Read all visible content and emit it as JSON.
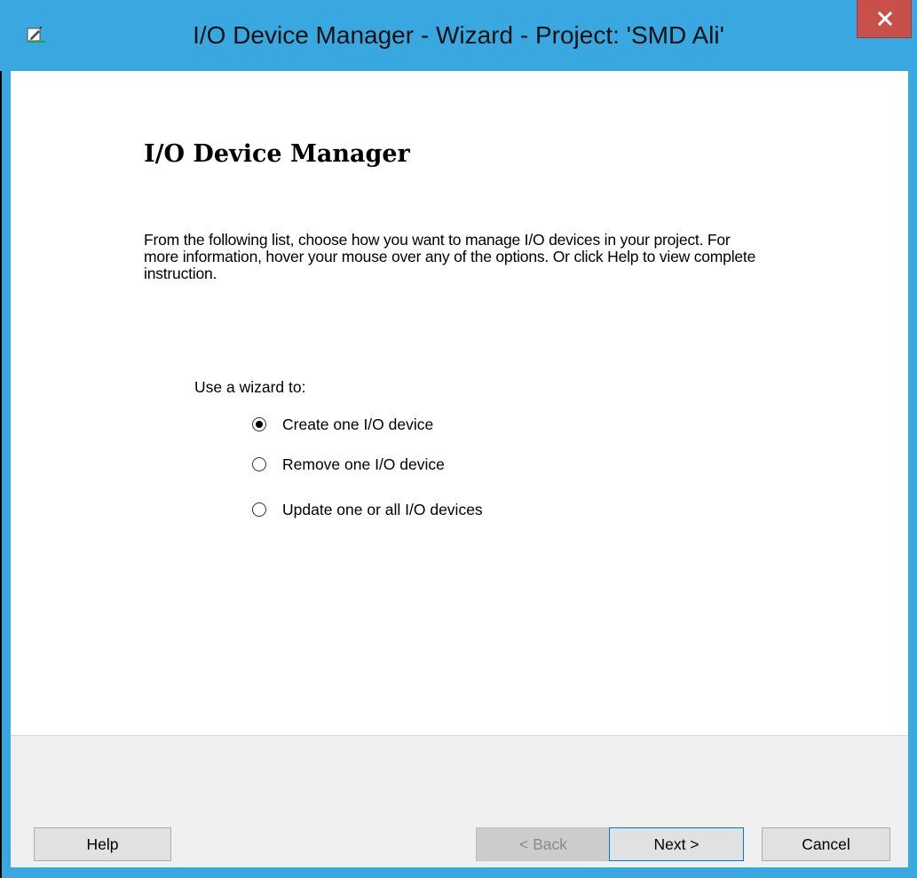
{
  "window": {
    "title": "I/O Device Manager - Wizard - Project: 'SMD Ali'",
    "app_icon": "edit-form-icon",
    "close_icon": "close-icon",
    "title_bar_color": "#3aa8e0",
    "close_button_color": "#c7504a"
  },
  "page": {
    "heading": "I/O Device Manager",
    "intro": "From the following list, choose how you want to manage I/O devices in your project. For more information, hover your mouse over any of the options. Or click Help to view complete instruction."
  },
  "options": {
    "group_label": "Use a wizard to:",
    "items": [
      {
        "label": "Create one I/O device",
        "checked": true
      },
      {
        "label": "Remove one I/O device",
        "checked": false
      },
      {
        "label": "Update one or all I/O devices",
        "checked": false
      }
    ]
  },
  "footer": {
    "help_label": "Help",
    "back_label": "< Back",
    "back_enabled": false,
    "next_label": "Next >",
    "cancel_label": "Cancel"
  }
}
